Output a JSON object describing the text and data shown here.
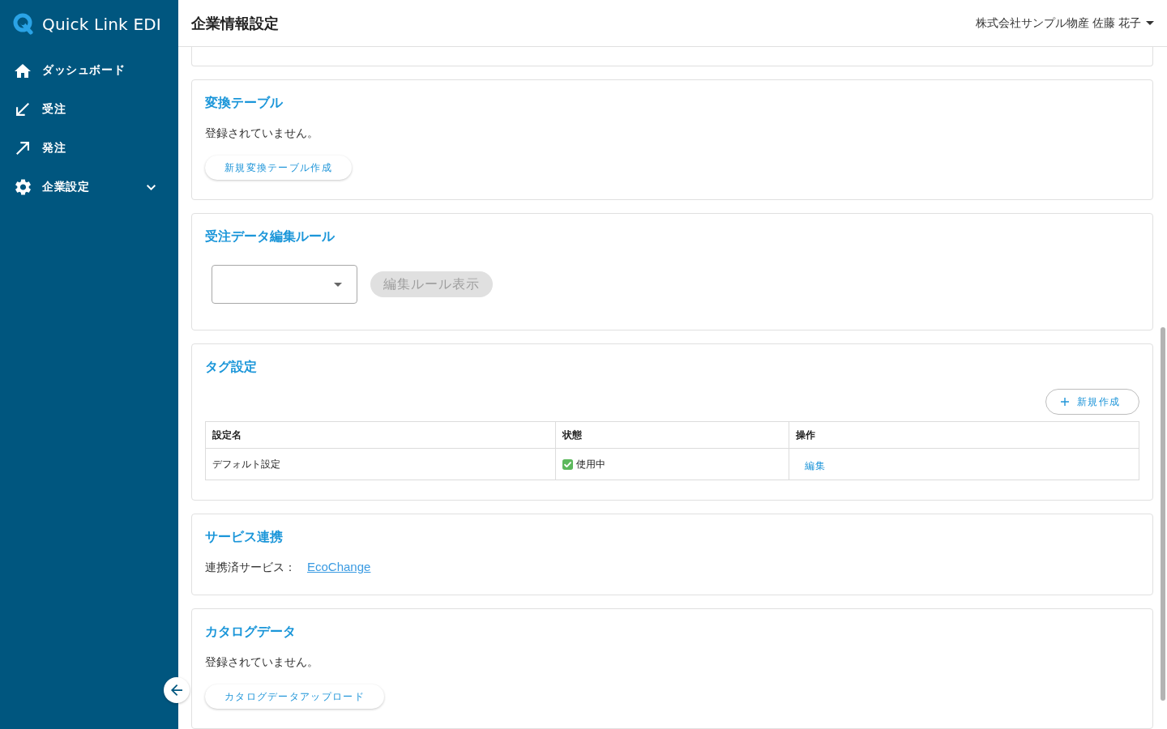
{
  "sidebar": {
    "logo": "Quick Link EDI",
    "items": [
      {
        "kind": "link",
        "label": "ダッシュボード",
        "selected": false
      },
      {
        "kind": "link",
        "label": "受注",
        "selected": false
      },
      {
        "kind": "link",
        "label": "発注",
        "selected": false
      },
      {
        "kind": "group",
        "label": "企業設定",
        "selected": false,
        "expanded": false
      }
    ]
  },
  "header": {
    "title": "企業情報設定",
    "user": "株式会社サンプル物産 佐藤 花子"
  },
  "sections": [
    {
      "kind": "empty",
      "title": "変換テーブル",
      "message": "登録されていません。",
      "button": "新規変換テーブル作成"
    },
    {
      "kind": "rule",
      "title": "受注データ編集ルール",
      "button": {
        "label": "編集ルール表示",
        "disabled": true
      }
    },
    {
      "kind": "table",
      "title": "タグ設定",
      "add_button": "新規作成",
      "table": {
        "columns": [
          "設定名",
          "状態",
          "操作"
        ],
        "rows": [
          {
            "name": "デフォルト設定",
            "status": "使用中",
            "in_use": true,
            "action": "編集"
          }
        ]
      }
    },
    {
      "kind": "links",
      "title": "サービス連携",
      "label": "連携済サービス：",
      "link": "EcoChange"
    },
    {
      "kind": "empty",
      "title": "カタログデータ",
      "message": "登録されていません。",
      "button": "カタログデータアップロード"
    }
  ]
}
